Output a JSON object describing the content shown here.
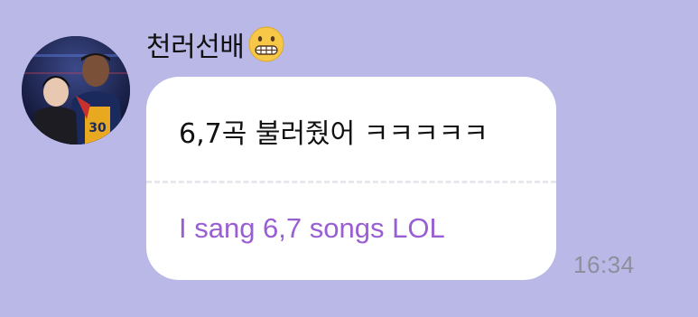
{
  "message": {
    "sender_name": "천러선배",
    "sender_emoji": "grimacing-face-emoji",
    "original_text": "6,7곡 불러줬어 ㅋㅋㅋㅋㅋ",
    "translated_text": "I sang 6,7 songs LOL",
    "timestamp": "16:34"
  },
  "colors": {
    "background": "#b9b8e6",
    "bubble": "#ffffff",
    "translation": "#9a5ed4",
    "timestamp": "#8e8e9c"
  }
}
